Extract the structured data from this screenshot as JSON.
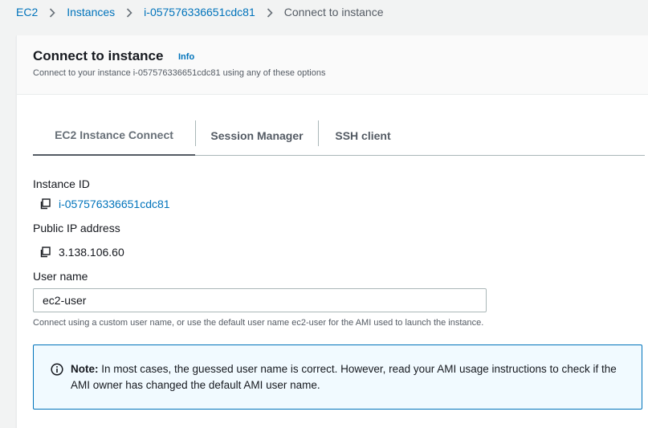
{
  "breadcrumb": {
    "items": [
      {
        "label": "EC2"
      },
      {
        "label": "Instances"
      },
      {
        "label": "i-057576336651cdc81"
      },
      {
        "label": "Connect to instance"
      }
    ]
  },
  "header": {
    "title": "Connect to instance",
    "info_link": "Info",
    "subtitle": "Connect to your instance i-057576336651cdc81 using any of these options"
  },
  "tabs": [
    {
      "label": "EC2 Instance Connect",
      "active": true
    },
    {
      "label": "Session Manager",
      "active": false
    },
    {
      "label": "SSH client",
      "active": false
    }
  ],
  "form": {
    "instance_id_label": "Instance ID",
    "instance_id_value": "i-057576336651cdc81",
    "public_ip_label": "Public IP address",
    "public_ip_value": "3.138.106.60",
    "user_name_label": "User name",
    "user_name_value": "ec2-user",
    "user_name_hint": "Connect using a custom user name, or use the default user name ec2-user for the AMI used to launch the instance."
  },
  "note": {
    "prefix": "Note:",
    "text": " In most cases, the guessed user name is correct. However, read your AMI usage instructions to check if the AMI owner has changed the default AMI user name."
  },
  "icons": {
    "copy": "copy-icon",
    "info": "info-circle-icon",
    "chevron": "chevron-right-icon"
  },
  "colors": {
    "link": "#0073bb",
    "note_bg": "#f1faff",
    "note_border": "#0073bb",
    "page_bg": "#f2f3f3"
  }
}
